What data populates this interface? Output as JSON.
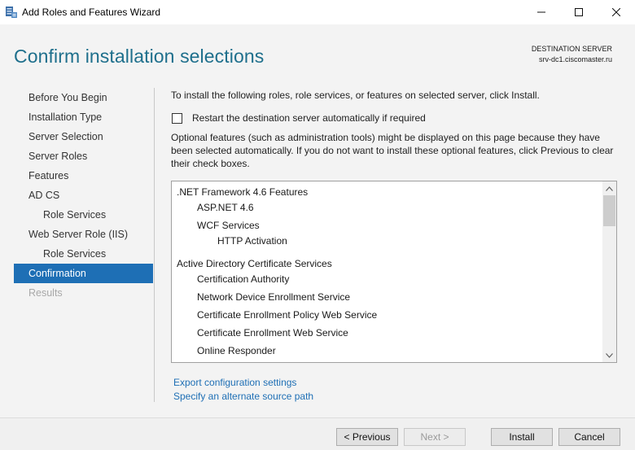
{
  "window": {
    "title": "Add Roles and Features Wizard",
    "icon": "server-manager-icon"
  },
  "header": {
    "page_title": "Confirm installation selections",
    "destination_label": "DESTINATION SERVER",
    "destination_server": "srv-dc1.ciscomaster.ru"
  },
  "nav": {
    "items": [
      {
        "label": "Before You Begin",
        "level": 0,
        "state": "normal"
      },
      {
        "label": "Installation Type",
        "level": 0,
        "state": "normal"
      },
      {
        "label": "Server Selection",
        "level": 0,
        "state": "normal"
      },
      {
        "label": "Server Roles",
        "level": 0,
        "state": "normal"
      },
      {
        "label": "Features",
        "level": 0,
        "state": "normal"
      },
      {
        "label": "AD CS",
        "level": 0,
        "state": "normal"
      },
      {
        "label": "Role Services",
        "level": 1,
        "state": "normal"
      },
      {
        "label": "Web Server Role (IIS)",
        "level": 0,
        "state": "normal"
      },
      {
        "label": "Role Services",
        "level": 1,
        "state": "normal"
      },
      {
        "label": "Confirmation",
        "level": 0,
        "state": "active"
      },
      {
        "label": "Results",
        "level": 0,
        "state": "disabled"
      }
    ]
  },
  "content": {
    "intro": "To install the following roles, role services, or features on selected server, click Install.",
    "restart_label": "Restart the destination server automatically if required",
    "restart_checked": false,
    "optional_note": "Optional features (such as administration tools) might be displayed on this page because they have been selected automatically. If you do not want to install these optional features, click Previous to clear their check boxes.",
    "selections": [
      {
        "label": ".NET Framework 4.6 Features",
        "level": 0
      },
      {
        "label": "ASP.NET 4.6",
        "level": 1
      },
      {
        "label": "WCF Services",
        "level": 1
      },
      {
        "label": "HTTP Activation",
        "level": 2
      },
      {
        "label": "Active Directory Certificate Services",
        "level": 0
      },
      {
        "label": "Certification Authority",
        "level": 1
      },
      {
        "label": "Network Device Enrollment Service",
        "level": 1
      },
      {
        "label": "Certificate Enrollment Policy Web Service",
        "level": 1
      },
      {
        "label": "Certificate Enrollment Web Service",
        "level": 1
      },
      {
        "label": "Online Responder",
        "level": 1
      }
    ],
    "export_link": "Export configuration settings",
    "alternate_source_link": "Specify an alternate source path"
  },
  "footer": {
    "previous_label": "< Previous",
    "next_label": "Next >",
    "install_label": "Install",
    "cancel_label": "Cancel"
  },
  "colors": {
    "accent": "#1e6fb5",
    "title": "#1e6f8c"
  }
}
